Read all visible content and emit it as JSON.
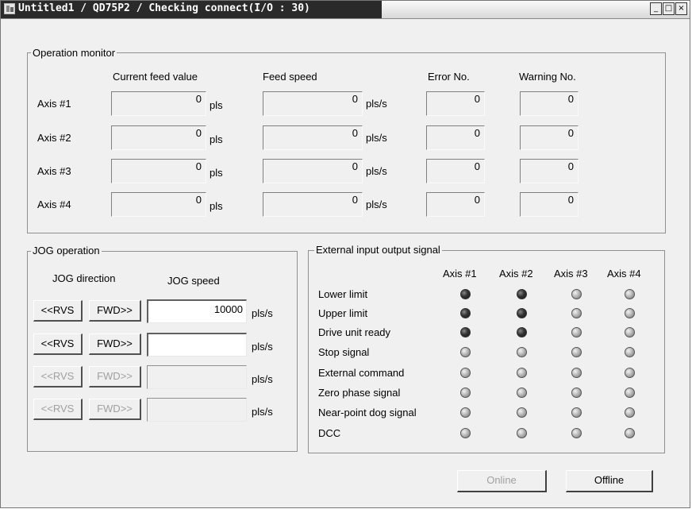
{
  "window": {
    "title": "Untitled1 / QD75P2 / Checking connect(I/O : 30)",
    "controls": {
      "minimize": "_",
      "maximize": "□",
      "close": "×"
    }
  },
  "operation_monitor": {
    "title": "Operation monitor",
    "headers": {
      "current_feed_value": "Current feed value",
      "feed_speed": "Feed speed",
      "error_no": "Error No.",
      "warning_no": "Warning No."
    },
    "units": {
      "position": "pls",
      "speed": "pls/s"
    },
    "rows": [
      {
        "axis": "Axis #1",
        "current_feed_value": "0",
        "feed_speed": "0",
        "error_no": "0",
        "warning_no": "0"
      },
      {
        "axis": "Axis #2",
        "current_feed_value": "0",
        "feed_speed": "0",
        "error_no": "0",
        "warning_no": "0"
      },
      {
        "axis": "Axis #3",
        "current_feed_value": "0",
        "feed_speed": "0",
        "error_no": "0",
        "warning_no": "0"
      },
      {
        "axis": "Axis #4",
        "current_feed_value": "0",
        "feed_speed": "0",
        "error_no": "0",
        "warning_no": "0"
      }
    ]
  },
  "jog_operation": {
    "title": "JOG operation",
    "direction_header": "JOG direction",
    "speed_header": "JOG speed",
    "rvs_label": "<<RVS",
    "fwd_label": "FWD>>",
    "unit": "pls/s",
    "rows": [
      {
        "speed": "10000",
        "enabled": true
      },
      {
        "speed": "",
        "enabled": true
      },
      {
        "speed": "",
        "enabled": false
      },
      {
        "speed": "",
        "enabled": false
      }
    ]
  },
  "external_io": {
    "title": "External input output signal",
    "axes": [
      "Axis #1",
      "Axis #2",
      "Axis #3",
      "Axis #4"
    ],
    "signals": [
      {
        "name": "Lower limit",
        "states": [
          "on",
          "on",
          "off",
          "off"
        ]
      },
      {
        "name": "Upper limit",
        "states": [
          "on",
          "on",
          "off",
          "off"
        ]
      },
      {
        "name": "Drive unit ready",
        "states": [
          "on",
          "on",
          "off",
          "off"
        ]
      },
      {
        "name": "Stop signal",
        "states": [
          "off",
          "off",
          "off",
          "off"
        ]
      },
      {
        "name": "External command",
        "states": [
          "off",
          "off",
          "off",
          "off"
        ]
      },
      {
        "name": "Zero phase signal",
        "states": [
          "off",
          "off",
          "off",
          "off"
        ]
      },
      {
        "name": "Near-point dog signal",
        "states": [
          "off",
          "off",
          "off",
          "off"
        ]
      },
      {
        "name": "DCC",
        "states": [
          "off",
          "off",
          "off",
          "off"
        ]
      }
    ]
  },
  "footer": {
    "online_label": "Online",
    "online_enabled": false,
    "offline_label": "Offline"
  }
}
